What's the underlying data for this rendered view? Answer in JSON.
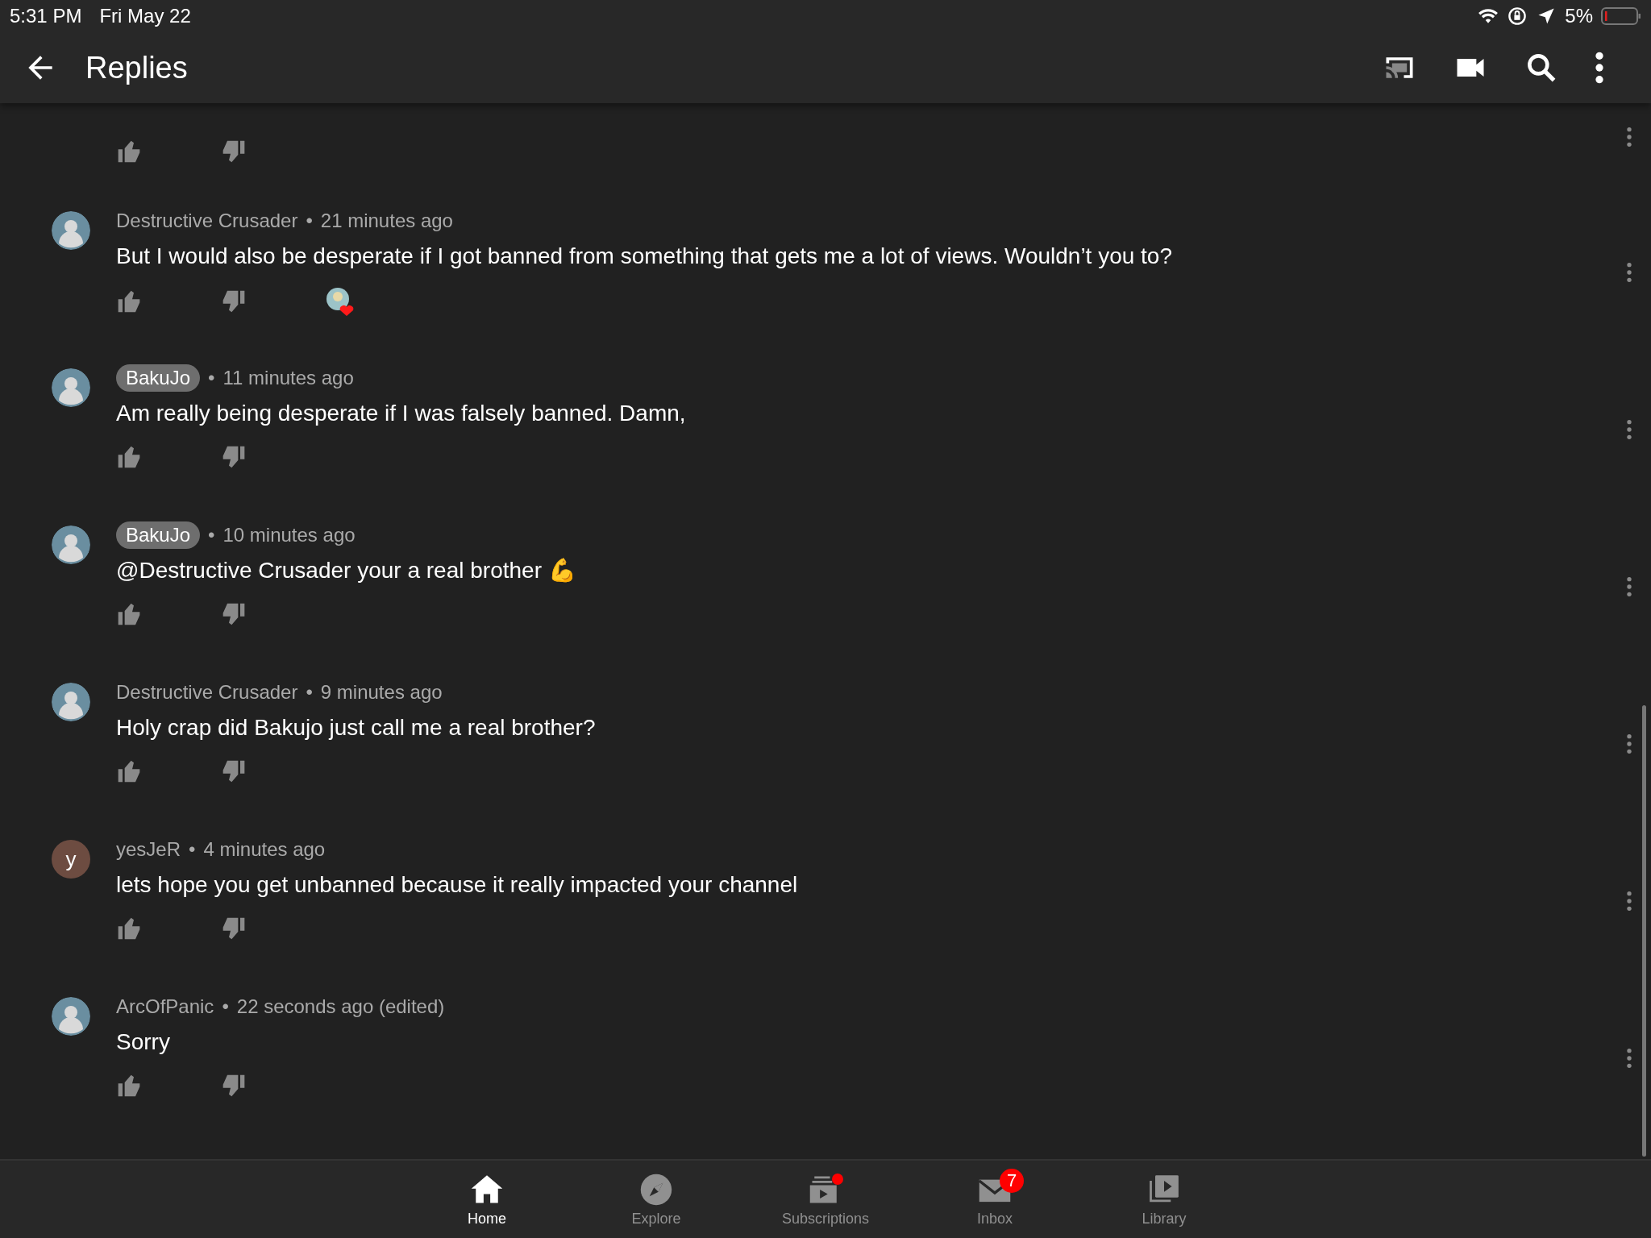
{
  "status_bar": {
    "time": "5:31 PM",
    "date": "Fri May 22",
    "battery": "5%"
  },
  "header": {
    "title": "Replies"
  },
  "comments": [
    {
      "kind": "partial"
    },
    {
      "kind": "comment",
      "author": "Destructive Crusader",
      "owner": false,
      "separator": "•",
      "time": "21 minutes ago",
      "text": "But I would also be desperate if I got banned from something that gets me a lot of views. Wouldn’t you to?",
      "hearted": true,
      "avatar": {
        "kind": "picture"
      }
    },
    {
      "kind": "comment",
      "author": "BakuJo",
      "owner": true,
      "separator": "•",
      "time": "11 minutes ago",
      "text": "Am really being desperate if I was falsely banned. Damn,",
      "hearted": false,
      "avatar": {
        "kind": "picture"
      }
    },
    {
      "kind": "comment",
      "author": "BakuJo",
      "owner": true,
      "separator": "•",
      "time": "10 minutes ago",
      "text": "@Destructive Crusader your a real brother 💪",
      "hearted": false,
      "avatar": {
        "kind": "picture"
      }
    },
    {
      "kind": "comment",
      "author": "Destructive Crusader",
      "owner": false,
      "separator": "•",
      "time": "9 minutes ago",
      "text": "Holy crap did Bakujo just call me a real brother?",
      "hearted": false,
      "avatar": {
        "kind": "picture"
      }
    },
    {
      "kind": "comment",
      "author": "yesJeR",
      "owner": false,
      "separator": "•",
      "time": "4 minutes ago",
      "text": "lets hope you get unbanned because it really impacted your channel",
      "hearted": false,
      "avatar": {
        "kind": "letter",
        "letter": "y"
      }
    },
    {
      "kind": "comment",
      "author": "ArcOfPanic",
      "owner": false,
      "separator": "•",
      "time": "22 seconds ago (edited)",
      "text": "Sorry",
      "hearted": false,
      "avatar": {
        "kind": "picture"
      }
    }
  ],
  "bottom_nav": [
    {
      "label": "Home",
      "kind": "home",
      "selected": true
    },
    {
      "label": "Explore",
      "kind": "explore",
      "selected": false
    },
    {
      "label": "Subscriptions",
      "kind": "subscriptions",
      "selected": false,
      "dot": true
    },
    {
      "label": "Inbox",
      "kind": "inbox",
      "selected": false,
      "badge": "7"
    },
    {
      "label": "Library",
      "kind": "library",
      "selected": false
    }
  ]
}
